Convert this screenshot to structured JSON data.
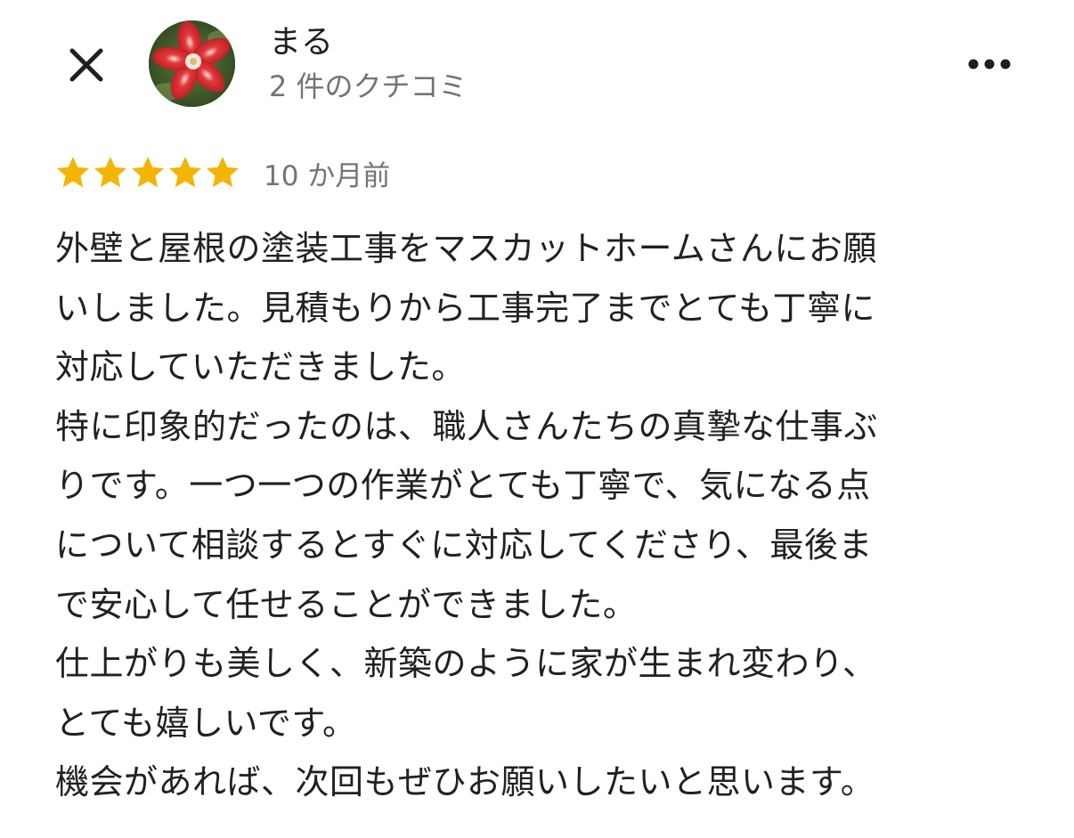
{
  "header": {
    "reviewer_name": "まる",
    "review_count": "2 件のクチコミ"
  },
  "review": {
    "rating": 5,
    "max_rating": 5,
    "star_color": "#f4b400",
    "date": "10 か月前",
    "lines": [
      "外壁と屋根の塗装工事をマスカットホームさんにお願",
      "いしました。見積もりから工事完了までとても丁寧に",
      "対応していただきました。",
      "特に印象的だったのは、職人さんたちの真摯な仕事ぶ",
      "りです。一つ一つの作業がとても丁寧で、気になる点",
      "について相談するとすぐに対応してくださり、最後ま",
      "で安心して任せることができました。",
      "仕上がりも美しく、新築のように家が生まれ変わり、",
      "とても嬉しいです。",
      "機会があれば、次回もぜひお願いしたいと思います。"
    ]
  },
  "icons": {
    "close": "close-icon",
    "more": "more-vert-icon",
    "star": "star-icon",
    "avatar": "flower-photo"
  }
}
